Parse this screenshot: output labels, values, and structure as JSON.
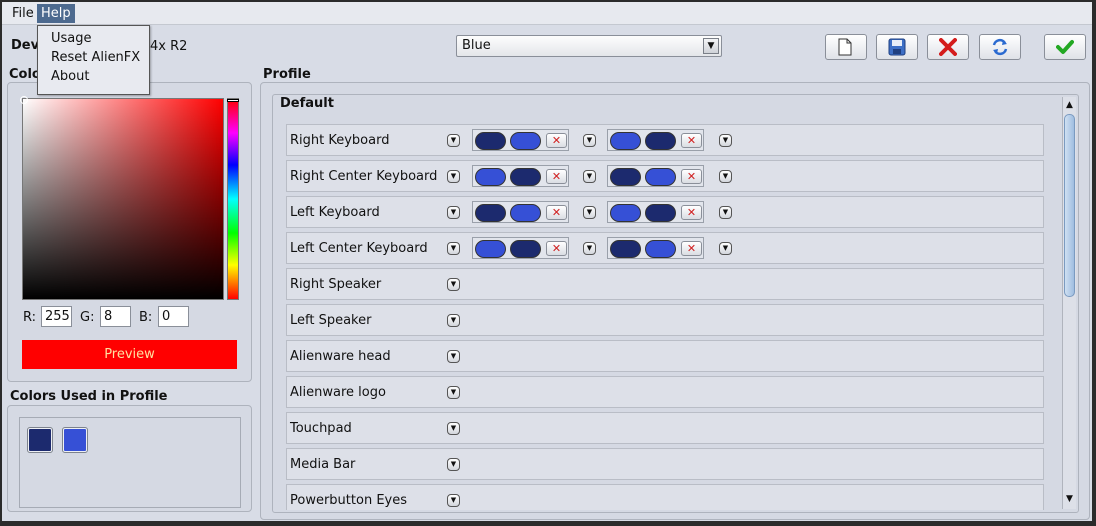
{
  "menubar": {
    "file": "File",
    "help": "Help"
  },
  "help_menu": {
    "items": [
      "Usage",
      "Reset AlienFX",
      "About"
    ]
  },
  "device": {
    "label_visible": "Dev",
    "model_visible": "4x R2"
  },
  "profile_select": {
    "value": "Blue"
  },
  "toolbar": {
    "icons": [
      "new-file-icon",
      "save-icon",
      "delete-icon",
      "refresh-icon",
      "apply-check-icon"
    ]
  },
  "color_panel": {
    "title_visible": "Colo",
    "r_label": "R:",
    "g_label": "G:",
    "b_label": "B:",
    "r": "255",
    "g": "8",
    "b": "0",
    "preview_label": "Preview",
    "preview_color": "#ff0800"
  },
  "used_colors": {
    "title": "Colors Used in Profile",
    "swatches": [
      "#1c2a6e",
      "#3650d6"
    ]
  },
  "profile": {
    "title": "Profile",
    "group": "Default",
    "zones": [
      "Right Keyboard",
      "Right Center Keyboard",
      "Left Keyboard",
      "Left Center Keyboard",
      "Right Speaker",
      "Left Speaker",
      "Alienware head",
      "Alienware logo",
      "Touchpad",
      "Media Bar",
      "Powerbutton Eyes"
    ]
  },
  "colors": {
    "dark_blue": "#1c2a6e",
    "light_blue": "#3650d6",
    "menu_highlight": "#4d6a8f"
  }
}
